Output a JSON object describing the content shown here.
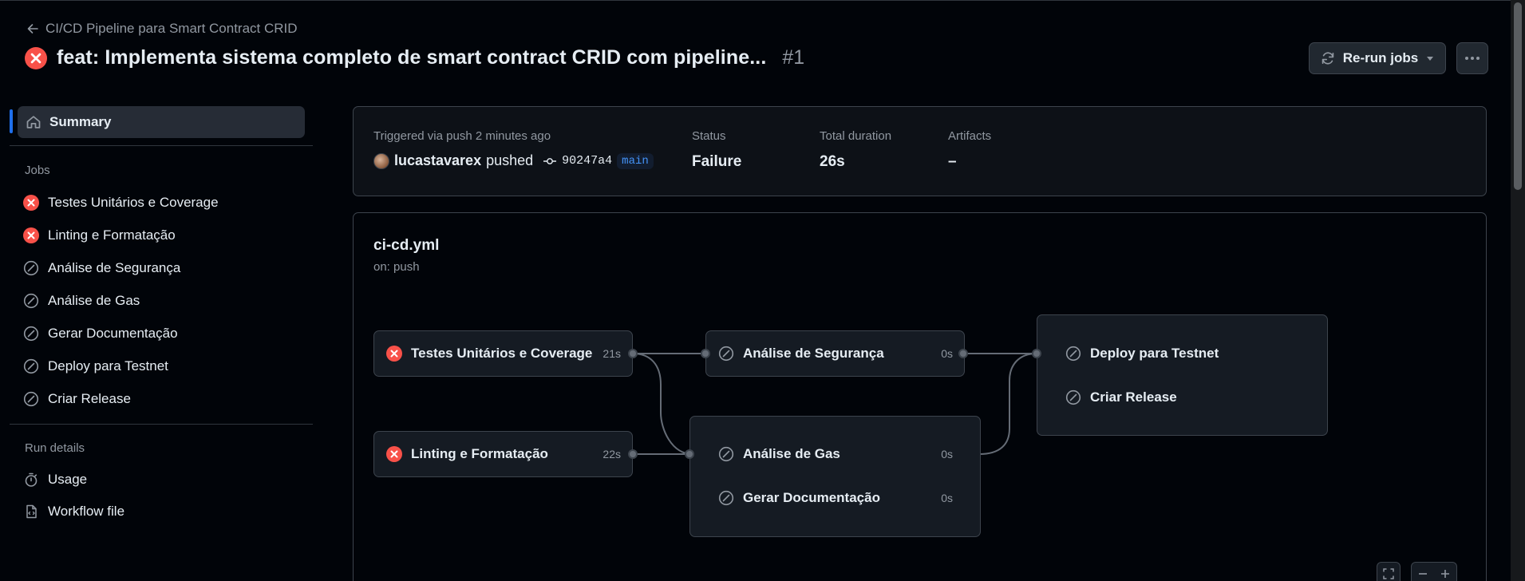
{
  "header": {
    "back_label": "CI/CD Pipeline para Smart Contract CRID",
    "title": "feat: Implementa sistema completo de smart contract CRID com pipeline...",
    "run_number": "#1",
    "rerun_label": "Re-run jobs"
  },
  "sidebar": {
    "summary_label": "Summary",
    "jobs_heading": "Jobs",
    "jobs": [
      {
        "label": "Testes Unitários e Coverage",
        "status": "failure"
      },
      {
        "label": "Linting e Formatação",
        "status": "failure"
      },
      {
        "label": "Análise de Segurança",
        "status": "skipped"
      },
      {
        "label": "Análise de Gas",
        "status": "skipped"
      },
      {
        "label": "Gerar Documentação",
        "status": "skipped"
      },
      {
        "label": "Deploy para Testnet",
        "status": "skipped"
      },
      {
        "label": "Criar Release",
        "status": "skipped"
      }
    ],
    "run_details_heading": "Run details",
    "usage_label": "Usage",
    "workflow_file_label": "Workflow file"
  },
  "summary": {
    "trigger_label": "Triggered via push 2 minutes ago",
    "user": "lucastavarex",
    "action": "pushed",
    "sha": "90247a4",
    "branch": "main",
    "status_label": "Status",
    "status_value": "Failure",
    "duration_label": "Total duration",
    "duration_value": "26s",
    "artifacts_label": "Artifacts",
    "artifacts_value": "–"
  },
  "graph": {
    "file": "ci-cd.yml",
    "trigger": "on: push",
    "nodes": {
      "tests": {
        "label": "Testes Unitários e Coverage",
        "duration": "21s",
        "status": "failure"
      },
      "lint": {
        "label": "Linting e Formatação",
        "duration": "22s",
        "status": "failure"
      },
      "security": {
        "label": "Análise de Segurança",
        "duration": "0s",
        "status": "skipped"
      },
      "gas": {
        "label": "Análise de Gas",
        "duration": "0s",
        "status": "skipped"
      },
      "docs": {
        "label": "Gerar Documentação",
        "duration": "0s",
        "status": "skipped"
      },
      "deploy": {
        "label": "Deploy para Testnet",
        "status": "skipped"
      },
      "release": {
        "label": "Criar Release",
        "status": "skipped"
      }
    }
  },
  "colors": {
    "failure": "#f85149",
    "skipped": "#9198a1",
    "accent": "#1f6feb",
    "branch_text": "#4493f8"
  }
}
